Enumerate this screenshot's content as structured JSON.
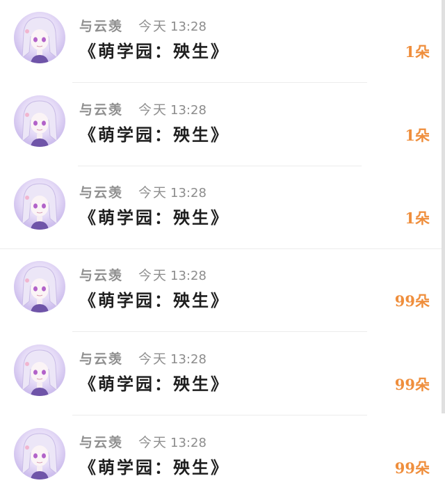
{
  "messages": [
    {
      "username": "与云羡",
      "when": "今天",
      "time": "13:28",
      "gift": "《萌学园：殃生》",
      "count": "1朵"
    },
    {
      "username": "与云羡",
      "when": "今天",
      "time": "13:28",
      "gift": "《萌学园：殃生》",
      "count": "1朵"
    },
    {
      "username": "与云羡",
      "when": "今天",
      "time": "13:28",
      "gift": "《萌学园：殃生》",
      "count": "1朵"
    },
    {
      "username": "与云羡",
      "when": "今天",
      "time": "13:28",
      "gift": "《萌学园：殃生》",
      "count": "99朵"
    },
    {
      "username": "与云羡",
      "when": "今天",
      "time": "13:28",
      "gift": "《萌学园：殃生》",
      "count": "99朵"
    },
    {
      "username": "与云羡",
      "when": "今天",
      "time": "13:28",
      "gift": "《萌学园：殃生》",
      "count": "99朵"
    }
  ],
  "icons": {
    "avatar": "anime-girl-avatar"
  },
  "colors": {
    "count_accent": "#ef8e3c",
    "meta_gray": "#8f8f8f",
    "title_text": "#1e1e1e"
  }
}
